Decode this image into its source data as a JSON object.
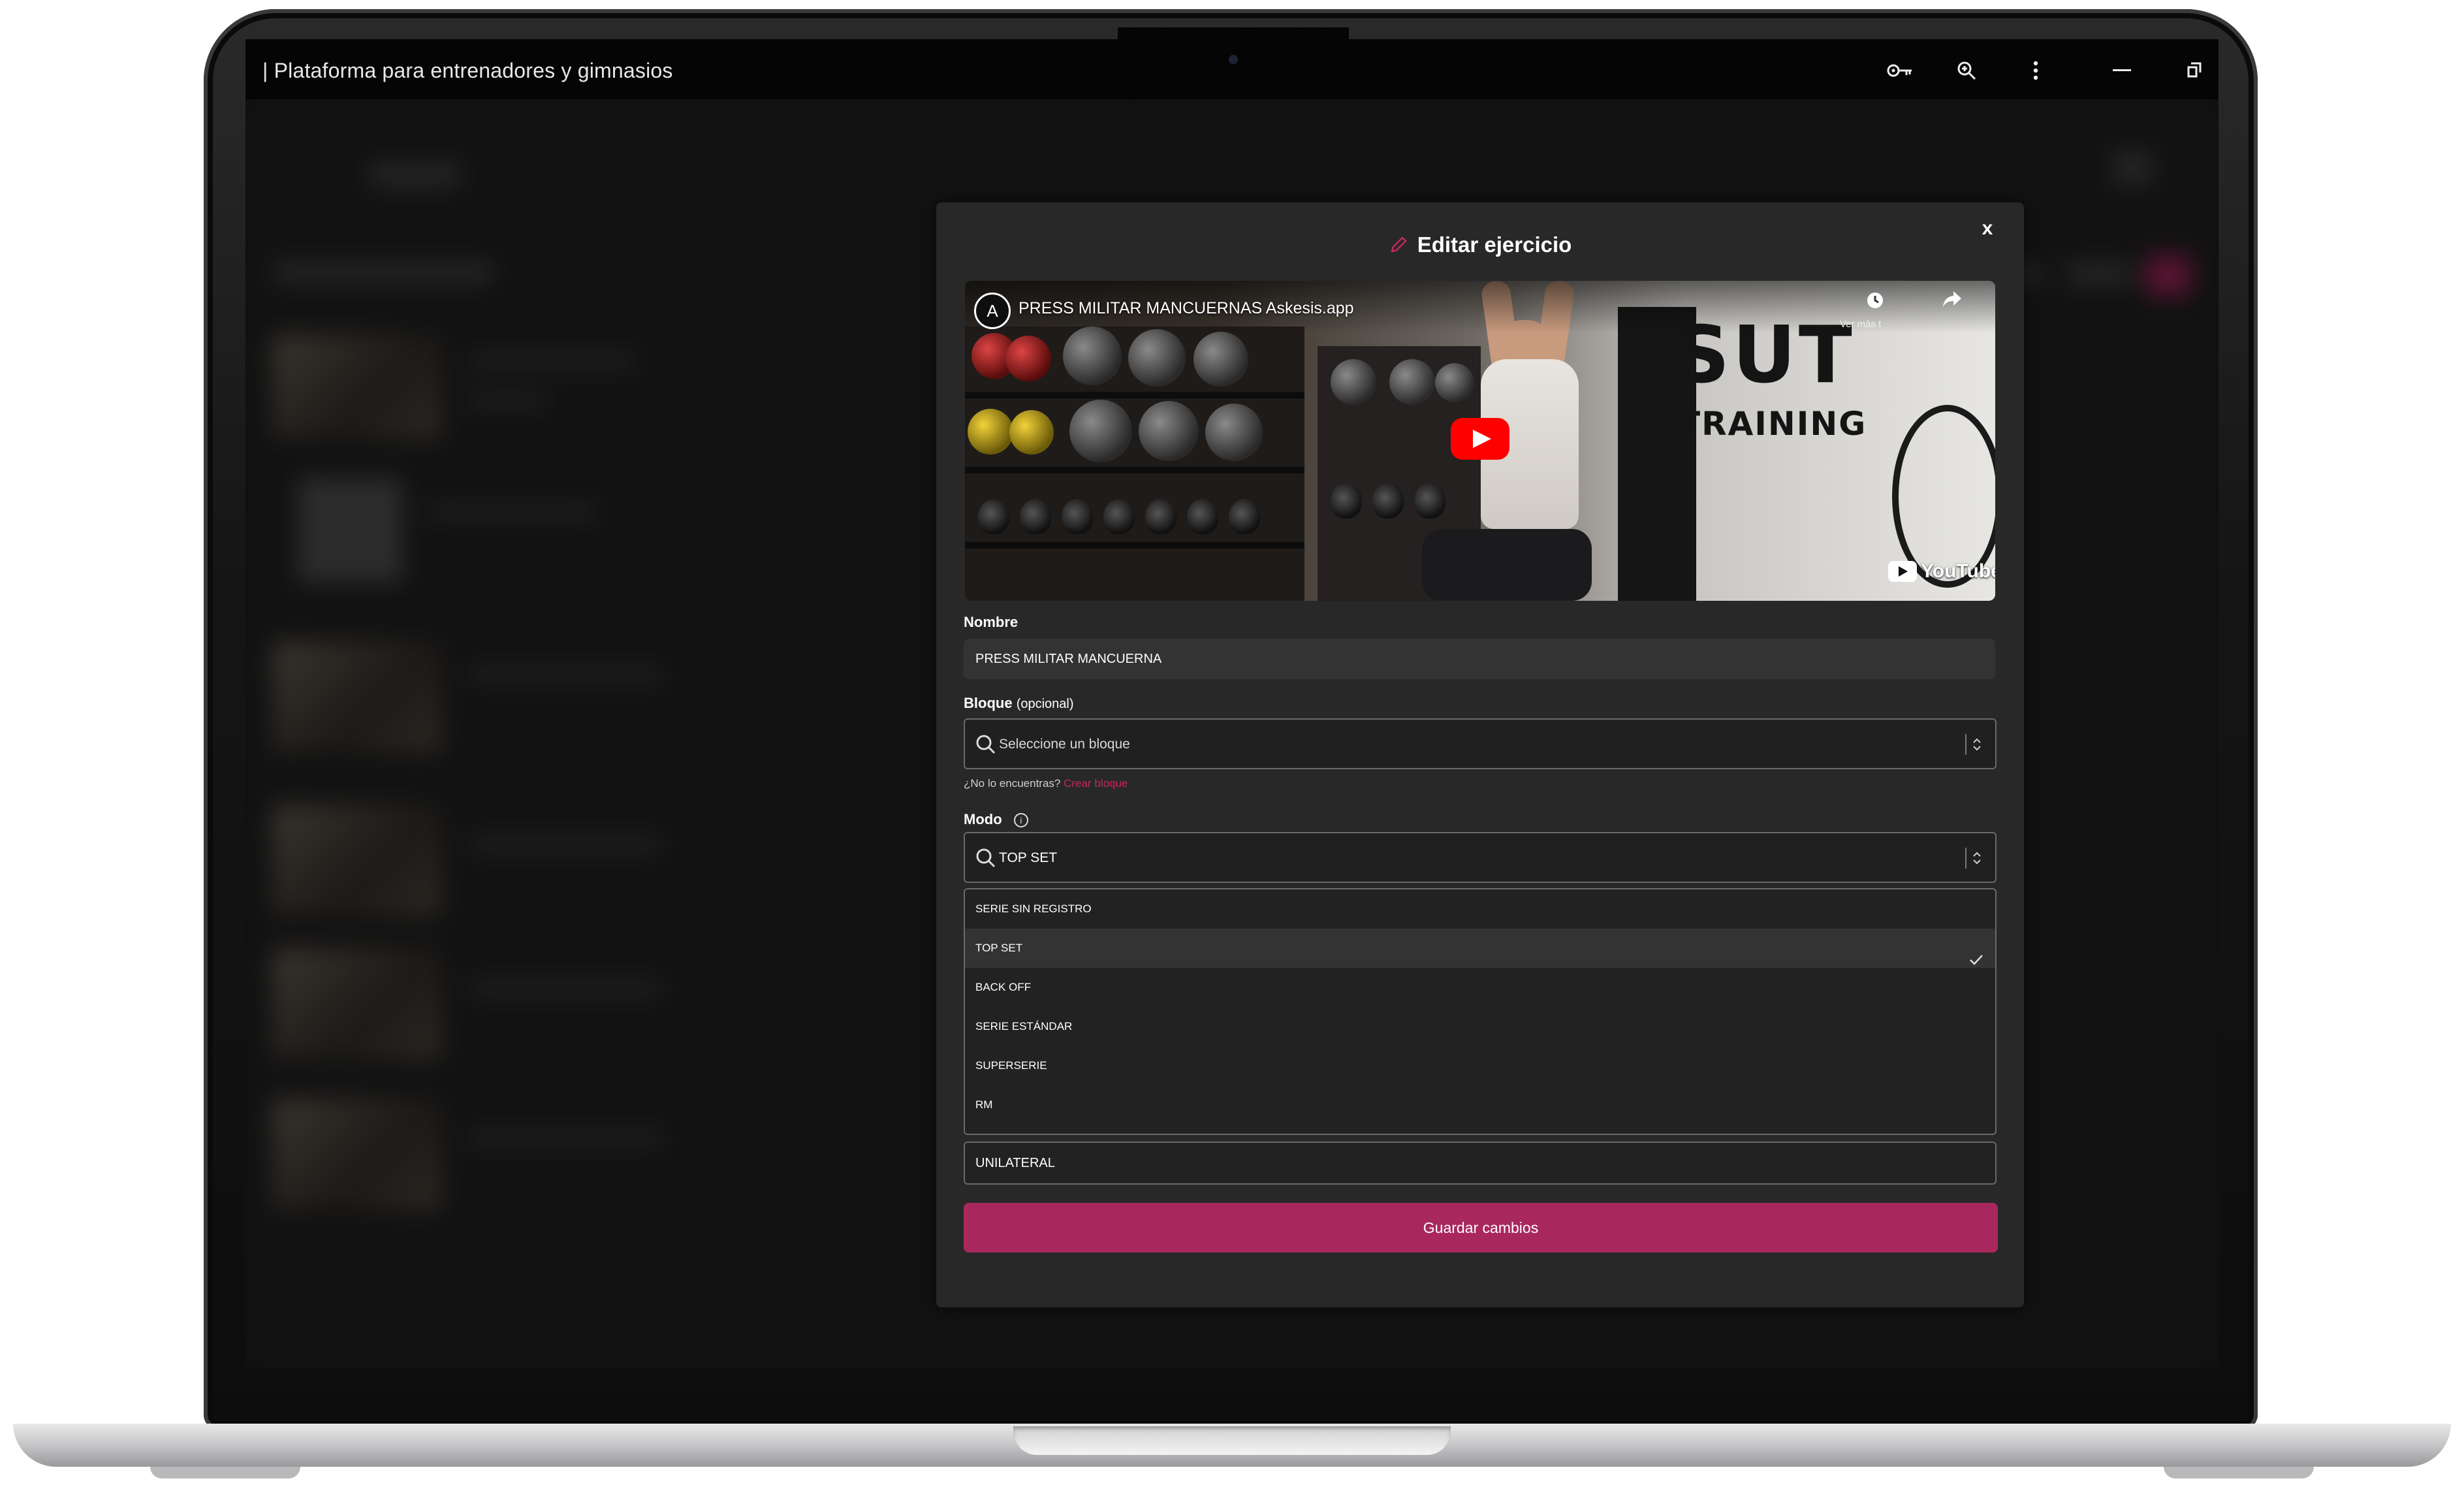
{
  "window": {
    "title": "| Plataforma para entrenadores y gimnasios"
  },
  "modal": {
    "title": "Editar ejercicio",
    "close_label": "x",
    "video": {
      "title": "PRESS MILITAR MANCUERNAS Askesis.app",
      "logo_letter": "A",
      "watch_later_label": "Ver más t",
      "brand": "YouTube",
      "wall_text_1": "SUT",
      "wall_text_2": "TRAINING"
    },
    "name": {
      "label": "Nombre",
      "value": "PRESS MILITAR MANCUERNA"
    },
    "block": {
      "label": "Bloque",
      "optional_label": "(opcional)",
      "placeholder": "Seleccione un bloque",
      "hint": "¿No lo encuentras?",
      "hint_link": "Crear bloque"
    },
    "mode": {
      "label": "Modo",
      "value": "TOP SET",
      "options": [
        {
          "label": "SERIE SIN REGISTRO",
          "selected": false
        },
        {
          "label": "TOP SET",
          "selected": true
        },
        {
          "label": "BACK OFF",
          "selected": false
        },
        {
          "label": "SERIE ESTÁNDAR",
          "selected": false
        },
        {
          "label": "SUPERSERIE",
          "selected": false
        },
        {
          "label": "RM",
          "selected": false
        }
      ]
    },
    "unilateral_label": "UNILATERAL",
    "save_label": "Guardar cambios"
  },
  "colors": {
    "accent": "#a8285d",
    "link": "#c2275f",
    "modal_bg": "#282828"
  }
}
